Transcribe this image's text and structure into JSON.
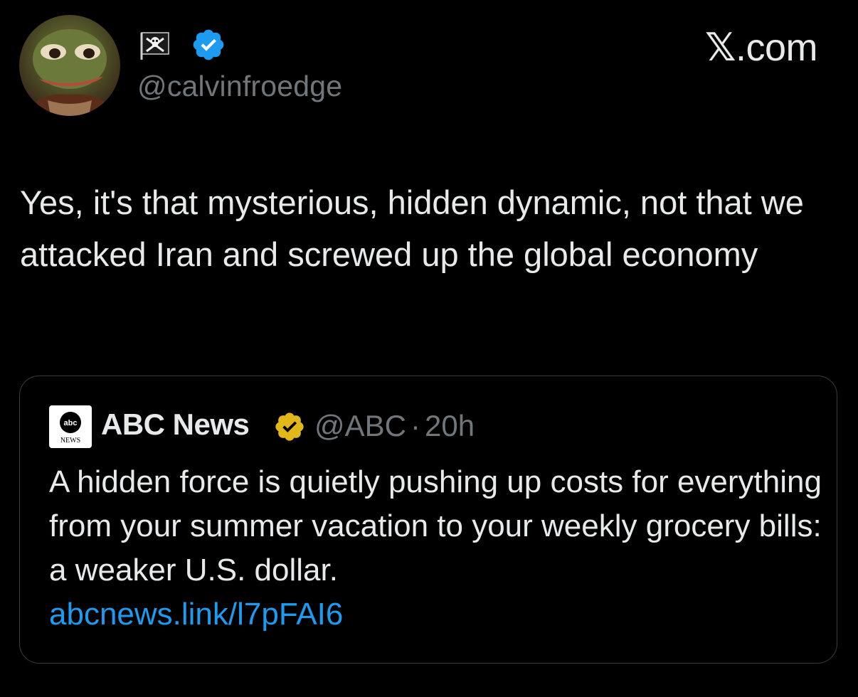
{
  "author": {
    "display_name_emoji": "pirate-flag",
    "handle": "@calvinfroedge",
    "verified_color": "#1d9bf0"
  },
  "brand": {
    "x_glyph": "𝕏",
    "suffix": ".com"
  },
  "tweet": {
    "text": "Yes, it's that mysterious, hidden dynamic, not that we attacked Iran and screwed up the global economy"
  },
  "quoted": {
    "name": "ABC News",
    "verified_color": "#e2b719",
    "handle": "@ABC",
    "separator": "·",
    "time": "20h",
    "text": "A hidden force is quietly pushing up costs for everything from your summer vacation to your weekly grocery bills: a weaker U.S. dollar.",
    "link": "abcnews.link/l7pFAI6",
    "logo_top": "abc",
    "logo_bottom": "NEWS"
  },
  "colors": {
    "background": "#000000",
    "text": "#e7e9ea",
    "muted": "#71767b",
    "link": "#1d9bf0",
    "border": "#3a3d40"
  }
}
